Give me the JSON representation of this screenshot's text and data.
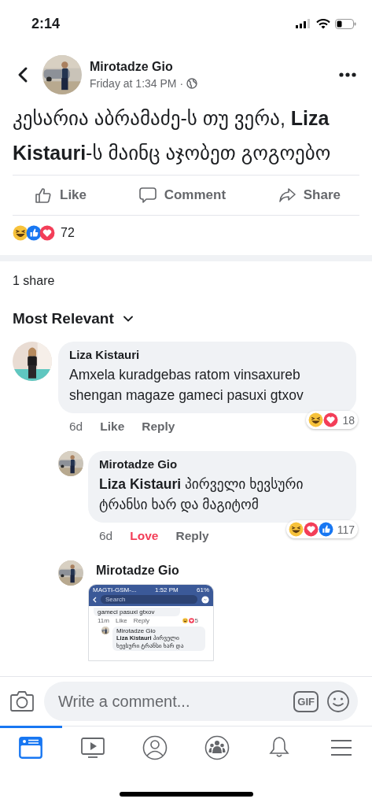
{
  "status_bar": {
    "time": "2:14"
  },
  "post": {
    "author": "Mirotadze Gio",
    "timestamp": "Friday at 1:34 PM ·",
    "text": "კესარია აბრამაძე-ს თუ ვერა, **Liza Kistauri**-ს მაინც აჯობეთ გოგოებო",
    "actions": [
      {
        "kind": "like",
        "label": "Like"
      },
      {
        "kind": "comment",
        "label": "Comment"
      },
      {
        "kind": "share",
        "label": "Share"
      }
    ],
    "reactions": [
      {
        "kind": "haha"
      },
      {
        "kind": "like"
      },
      {
        "kind": "love"
      }
    ],
    "reaction_count": "72",
    "shares": "1 share"
  },
  "comments_sort": "Most Relevant",
  "comments": [
    {
      "author": "Liza Kistauri",
      "text": "Amxela kuradgebas ratom vinsaxureb shengan magaze gameci pasuxi gtxov",
      "time": "6d",
      "reaction_button": {
        "label": "Like",
        "reacted": false
      },
      "reply_label": "Reply",
      "reactions": [
        {
          "kind": "haha"
        },
        {
          "kind": "love"
        }
      ],
      "reaction_count": "18",
      "children": [
        {
          "author": "Mirotadze Gio",
          "text": "**Liza Kistauri** პირველი ხევსური ტრანსი ხარ და მაგიტომ",
          "time": "6d",
          "reaction_button": {
            "label": "Love",
            "reacted": true
          },
          "reply_label": "Reply",
          "reactions": [
            {
              "kind": "haha"
            },
            {
              "kind": "love"
            },
            {
              "kind": "like"
            }
          ],
          "reaction_count": "117"
        },
        {
          "author": "Mirotadze Gio",
          "attachment": {
            "kind": "screenshot",
            "carrier": "MAGTI-GSM-...",
            "time": "1:52 PM",
            "battery": "61%",
            "search_placeholder": "Search",
            "comment_tail": "gameci pasuxi gtxov",
            "meta": [
              "11m",
              "Like",
              "Reply"
            ],
            "reaction_count": "5",
            "reply_author": "Mirotadze Gio",
            "reply_text": "**Liza Kistauri** პირველი ხევსური ტრანსი ხარ და"
          }
        }
      ]
    }
  ],
  "composer": {
    "placeholder": "Write a comment...",
    "gif_label": "GIF"
  },
  "tab_bar": [
    {
      "kind": "news",
      "selected": true
    },
    {
      "kind": "watch",
      "selected": false
    },
    {
      "kind": "profile",
      "selected": false
    },
    {
      "kind": "groups",
      "selected": false
    },
    {
      "kind": "notifications",
      "selected": false
    },
    {
      "kind": "menu",
      "selected": false
    }
  ]
}
